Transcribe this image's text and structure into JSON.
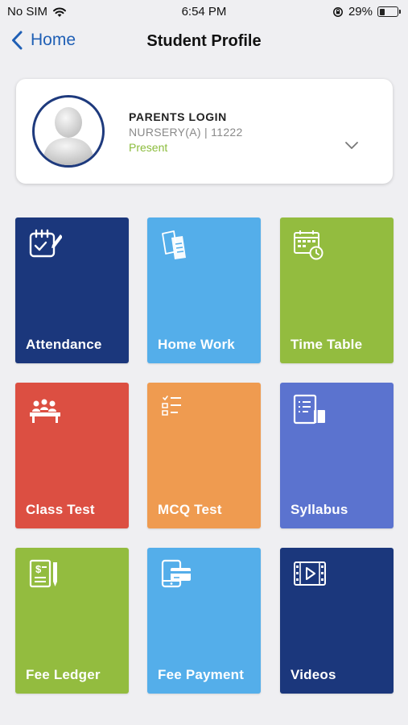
{
  "status_bar": {
    "carrier": "No SIM",
    "time": "6:54 PM",
    "battery_percent": "29%",
    "battery_level": 0.29
  },
  "nav": {
    "back_label": "Home",
    "title": "Student Profile"
  },
  "profile": {
    "name": "PARENTS LOGIN",
    "class_info": "NURSERY(A) | 11222",
    "status": "Present",
    "status_color": "#8bbc3c",
    "avatar_border_color": "#1e3a7d"
  },
  "tiles": [
    {
      "label": "Attendance",
      "icon": "attendance-icon",
      "color": "#1b377c"
    },
    {
      "label": "Home Work",
      "icon": "homework-icon",
      "color": "#54aeea"
    },
    {
      "label": "Time Table",
      "icon": "timetable-icon",
      "color": "#93bc3f"
    },
    {
      "label": "Class Test",
      "icon": "class-test-icon",
      "color": "#dc4f42"
    },
    {
      "label": "MCQ Test",
      "icon": "mcq-test-icon",
      "color": "#ef9b50"
    },
    {
      "label": "Syllabus",
      "icon": "syllabus-icon",
      "color": "#5b73cf"
    },
    {
      "label": "Fee Ledger",
      "icon": "fee-ledger-icon",
      "color": "#93bc3f"
    },
    {
      "label": "Fee Payment",
      "icon": "fee-payment-icon",
      "color": "#54aeea"
    },
    {
      "label": "Videos",
      "icon": "videos-icon",
      "color": "#1b377c"
    }
  ]
}
